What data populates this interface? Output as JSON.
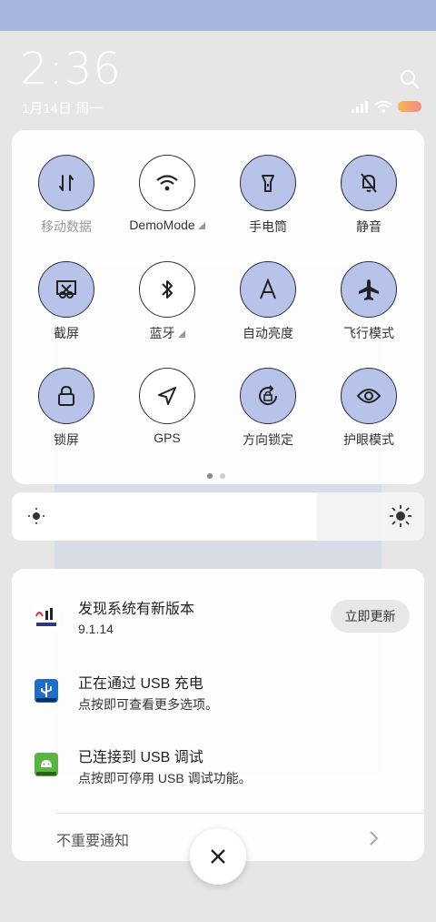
{
  "status": {
    "time": "2:36",
    "date": "1月14日 周一"
  },
  "tiles": [
    {
      "label": "移动数据",
      "icon": "mobile-data-icon",
      "active": true
    },
    {
      "label": "DemoMode",
      "icon": "wifi-icon",
      "active": false
    },
    {
      "label": "手电筒",
      "icon": "flashlight-icon",
      "active": true
    },
    {
      "label": "静音",
      "icon": "mute-bell-icon",
      "active": true
    },
    {
      "label": "截屏",
      "icon": "screenshot-icon",
      "active": true
    },
    {
      "label": "蓝牙",
      "icon": "bluetooth-icon",
      "active": false
    },
    {
      "label": "自动亮度",
      "icon": "auto-brightness-icon",
      "active": true
    },
    {
      "label": "飞行模式",
      "icon": "airplane-icon",
      "active": true
    },
    {
      "label": "锁屏",
      "icon": "lock-icon",
      "active": true
    },
    {
      "label": "GPS",
      "icon": "gps-icon",
      "active": false
    },
    {
      "label": "方向锁定",
      "icon": "rotation-lock-icon",
      "active": true
    },
    {
      "label": "护眼模式",
      "icon": "eye-icon",
      "active": true
    }
  ],
  "brightness": {
    "level": 0.74
  },
  "notifications": [
    {
      "title": "发现系统有新版本",
      "subtitle": "9.1.14",
      "action": "立即更新",
      "icon": "update-app-icon"
    },
    {
      "title": "正在通过 USB 充电",
      "subtitle": "点按即可查看更多选项。",
      "icon": "usb-icon"
    },
    {
      "title": "已连接到 USB 调试",
      "subtitle": "点按即可停用 USB 调试功能。",
      "icon": "android-debug-icon"
    }
  ],
  "footer": {
    "unimportant": "不重要通知"
  },
  "colors": {
    "tile_active": "#b8c3ea",
    "tile_border": "#2a2e45",
    "top_band": "#a7b4dc"
  }
}
